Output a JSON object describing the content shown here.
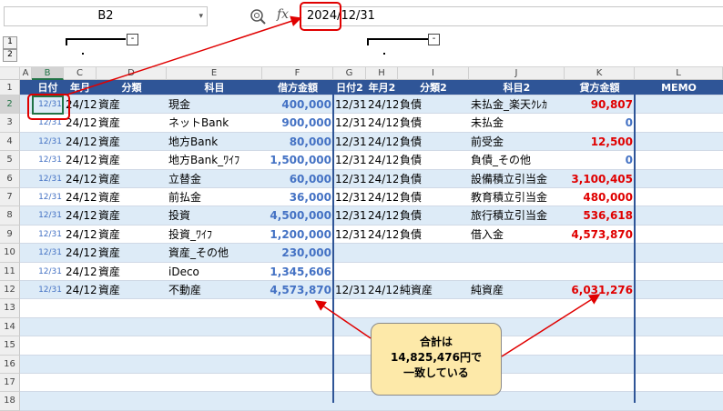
{
  "formula_bar": {
    "name_box": "B2",
    "formula": "2024/12/31",
    "zoom_icon": "zoom-icon",
    "fx_label": "fx"
  },
  "outline": {
    "levels": [
      "1",
      "2"
    ],
    "collapse_symbol": "-"
  },
  "columns": [
    "A",
    "B",
    "C",
    "D",
    "E",
    "F",
    "G",
    "H",
    "I",
    "J",
    "K",
    "L"
  ],
  "selected_column": "B",
  "headers": [
    "日付",
    "年月",
    "分類",
    "科目",
    "借方金額",
    "日付2",
    "年月2",
    "分類2",
    "科目2",
    "貸方金額",
    "MEMO"
  ],
  "rows": [
    [
      "12/31",
      "24/12",
      "資産",
      "現金",
      "400,000",
      "12/31",
      "24/12",
      "負債",
      "未払金_楽天ｸﾚｶ",
      "90,807",
      ""
    ],
    [
      "12/31",
      "24/12",
      "資産",
      "ネットBank",
      "900,000",
      "12/31",
      "24/12",
      "負債",
      "未払金",
      "0",
      ""
    ],
    [
      "12/31",
      "24/12",
      "資産",
      "地方Bank",
      "80,000",
      "12/31",
      "24/12",
      "負債",
      "前受金",
      "12,500",
      ""
    ],
    [
      "12/31",
      "24/12",
      "資産",
      "地方Bank_ﾜｲﾌ",
      "1,500,000",
      "12/31",
      "24/12",
      "負債",
      "負債_その他",
      "0",
      ""
    ],
    [
      "12/31",
      "24/12",
      "資産",
      "立替金",
      "60,000",
      "12/31",
      "24/12",
      "負債",
      "設備積立引当金",
      "3,100,405",
      ""
    ],
    [
      "12/31",
      "24/12",
      "資産",
      "前払金",
      "36,000",
      "12/31",
      "24/12",
      "負債",
      "教育積立引当金",
      "480,000",
      ""
    ],
    [
      "12/31",
      "24/12",
      "資産",
      "投資",
      "4,500,000",
      "12/31",
      "24/12",
      "負債",
      "旅行積立引当金",
      "536,618",
      ""
    ],
    [
      "12/31",
      "24/12",
      "資産",
      "投資_ﾜｲﾌ",
      "1,200,000",
      "12/31",
      "24/12",
      "負債",
      "借入金",
      "4,573,870",
      ""
    ],
    [
      "12/31",
      "24/12",
      "資産",
      "資産_その他",
      "230,000",
      "",
      "",
      "",
      "",
      "",
      ""
    ],
    [
      "12/31",
      "24/12",
      "資産",
      "iDeco",
      "1,345,606",
      "",
      "",
      "",
      "",
      "",
      ""
    ],
    [
      "12/31",
      "24/12",
      "資産",
      "不動産",
      "4,573,870",
      "12/31",
      "24/12",
      "純資産",
      "純資産",
      "6,031,276",
      ""
    ]
  ],
  "row_numbers": [
    "1",
    "2",
    "3",
    "4",
    "5",
    "6",
    "7",
    "8",
    "9",
    "10",
    "11",
    "12",
    "13",
    "14",
    "15",
    "16",
    "17",
    "18"
  ],
  "callout": {
    "line1": "合計は",
    "line2": "14,825,476円で",
    "line3": "一致している"
  },
  "colors": {
    "header_bg": "#2f5597",
    "band": "#ddebf7",
    "debit": "#4472c4",
    "credit": "#e00000",
    "callout": "#fde9a9",
    "arrow": "#e00000"
  }
}
